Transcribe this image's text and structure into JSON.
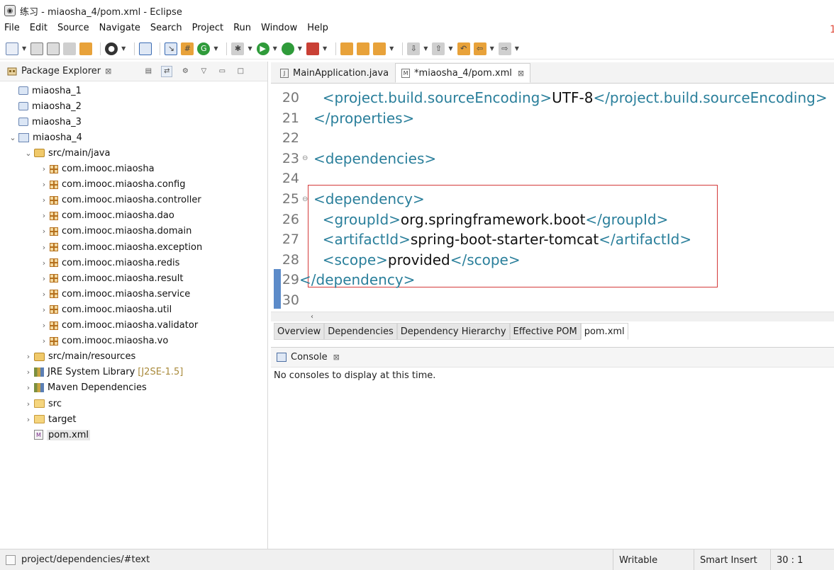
{
  "window": {
    "title": "练习 - miaosha_4/pom.xml - Eclipse"
  },
  "menu": [
    "File",
    "Edit",
    "Source",
    "Navigate",
    "Search",
    "Project",
    "Run",
    "Window",
    "Help"
  ],
  "explorer": {
    "title": "Package Explorer",
    "items": [
      {
        "label": "miaosha_1",
        "icon": "project-icon"
      },
      {
        "label": "miaosha_2",
        "icon": "project-icon"
      },
      {
        "label": "miaosha_3",
        "icon": "project-icon"
      },
      {
        "label": "miaosha_4",
        "icon": "maven-project-icon"
      },
      {
        "label": "src/main/java",
        "icon": "source-folder-icon"
      },
      {
        "label": "com.imooc.miaosha",
        "icon": "package-icon"
      },
      {
        "label": "com.imooc.miaosha.config",
        "icon": "package-icon"
      },
      {
        "label": "com.imooc.miaosha.controller",
        "icon": "package-icon"
      },
      {
        "label": "com.imooc.miaosha.dao",
        "icon": "package-icon"
      },
      {
        "label": "com.imooc.miaosha.domain",
        "icon": "package-icon"
      },
      {
        "label": "com.imooc.miaosha.exception",
        "icon": "package-icon"
      },
      {
        "label": "com.imooc.miaosha.redis",
        "icon": "package-icon"
      },
      {
        "label": "com.imooc.miaosha.result",
        "icon": "package-icon"
      },
      {
        "label": "com.imooc.miaosha.service",
        "icon": "package-icon"
      },
      {
        "label": "com.imooc.miaosha.util",
        "icon": "package-icon"
      },
      {
        "label": "com.imooc.miaosha.validator",
        "icon": "package-icon"
      },
      {
        "label": "com.imooc.miaosha.vo",
        "icon": "package-icon"
      },
      {
        "label": "src/main/resources",
        "icon": "source-folder-icon"
      },
      {
        "label": "JRE System Library",
        "suffix": "[J2SE-1.5]",
        "icon": "library-icon"
      },
      {
        "label": "Maven Dependencies",
        "icon": "library-icon"
      },
      {
        "label": "src",
        "icon": "folder-icon"
      },
      {
        "label": "target",
        "icon": "folder-icon"
      },
      {
        "label": "pom.xml",
        "icon": "xml-file-icon"
      }
    ]
  },
  "editor": {
    "tabs": [
      {
        "label": "MainApplication.java",
        "icon": "java-file-icon"
      },
      {
        "label": "*miaosha_4/pom.xml",
        "icon": "xml-file-icon"
      }
    ],
    "lines": [
      {
        "num": "20",
        "pre": "  <project.build.sourceEncoding>",
        "text": "UTF-8",
        "post": "</project.build.sourceEncoding>"
      },
      {
        "num": "21",
        "pre": "</properties>",
        "text": "",
        "post": ""
      },
      {
        "num": "22",
        "pre": "",
        "text": "",
        "post": ""
      },
      {
        "num": "23",
        "pre": "<dependencies>",
        "text": "",
        "post": ""
      },
      {
        "num": "24",
        "pre": "",
        "text": "",
        "post": ""
      },
      {
        "num": "25",
        "pre": "<dependency>",
        "text": "",
        "post": ""
      },
      {
        "num": "26",
        "pre": "  <groupId>",
        "text": "org.springframework.boot",
        "post": "</groupId>"
      },
      {
        "num": "27",
        "pre": "  <artifactId>",
        "text": "spring-boot-starter-tomcat",
        "post": "</artifactId>"
      },
      {
        "num": "28",
        "pre": "  <scope>",
        "text": "provided",
        "post": "</scope>"
      },
      {
        "num": "29",
        "pre": "</dependency>",
        "text": "",
        "post": ""
      },
      {
        "num": "30",
        "pre": "",
        "text": "",
        "post": ""
      }
    ],
    "pom_tabs": [
      "Overview",
      "Dependencies",
      "Dependency Hierarchy",
      "Effective POM",
      "pom.xml"
    ]
  },
  "console": {
    "title": "Console",
    "message": "No consoles to display at this time."
  },
  "status": {
    "path": "project/dependencies/#text",
    "writable": "Writable",
    "insert_mode": "Smart Insert",
    "position": "30 : 1"
  }
}
